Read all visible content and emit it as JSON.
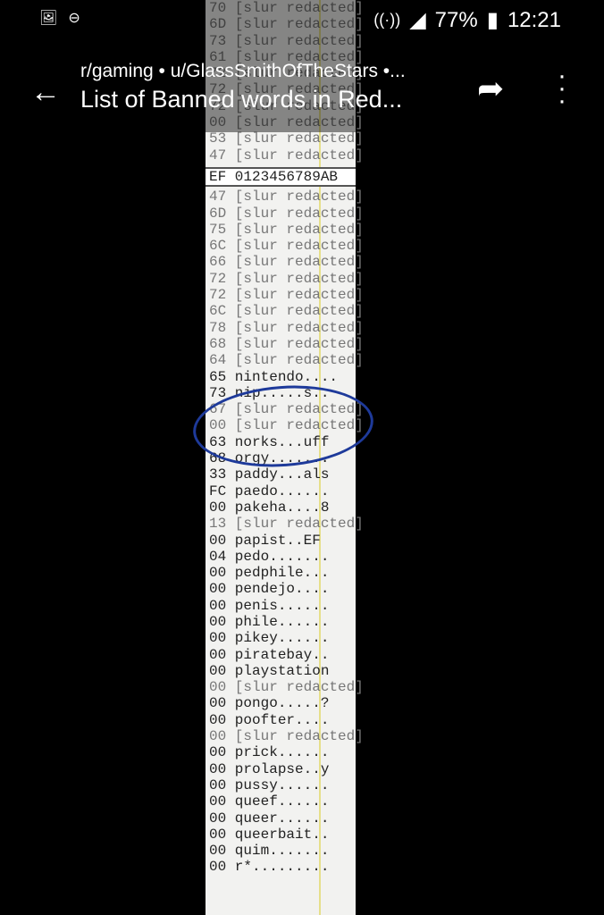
{
  "status_bar": {
    "icons_left": [
      "image-icon",
      "do-not-disturb-icon"
    ],
    "icons_right": [
      "bluetooth-icon",
      "alarm-icon",
      "volte-icon",
      "wifi-icon",
      "signal-icon"
    ],
    "battery": "77%",
    "time": "12:21"
  },
  "app_bar": {
    "subtitle": "r/gaming • u/GlassSmithOfTheStars •...",
    "title": "List of Banned words in Red..."
  },
  "dump": {
    "header": "EF 0123456789AB",
    "redacted_label": "[slur redacted]",
    "top_rows": [
      {
        "hex": "70",
        "word": null
      },
      {
        "hex": "6D",
        "word": null
      },
      {
        "hex": "73",
        "word": null
      },
      {
        "hex": "61",
        "word": null
      },
      {
        "hex": "72",
        "word": null
      },
      {
        "hex": "72",
        "word": null
      },
      {
        "hex": "72",
        "word": null
      },
      {
        "hex": "00",
        "word": null
      },
      {
        "hex": "53",
        "word": null
      },
      {
        "hex": "47",
        "word": null
      }
    ],
    "rows": [
      {
        "hex": "47",
        "word": null
      },
      {
        "hex": "6D",
        "word": null
      },
      {
        "hex": "75",
        "word": null
      },
      {
        "hex": "6C",
        "word": null
      },
      {
        "hex": "66",
        "word": null
      },
      {
        "hex": "72",
        "word": null
      },
      {
        "hex": "72",
        "word": null
      },
      {
        "hex": "6C",
        "word": null
      },
      {
        "hex": "78",
        "word": null
      },
      {
        "hex": "68",
        "word": null
      },
      {
        "hex": "64",
        "word": null
      },
      {
        "hex": "65",
        "word": "nintendo...."
      },
      {
        "hex": "73",
        "word": "nip.....s.."
      },
      {
        "hex": "67",
        "word": null
      },
      {
        "hex": "00",
        "word": null
      },
      {
        "hex": "63",
        "word": "norks...uff"
      },
      {
        "hex": "68",
        "word": "orgy......."
      },
      {
        "hex": "33",
        "word": "paddy...als"
      },
      {
        "hex": "FC",
        "word": "paedo......"
      },
      {
        "hex": "00",
        "word": "pakeha....8"
      },
      {
        "hex": "13",
        "word": null
      },
      {
        "hex": "00",
        "word": "papist..EF"
      },
      {
        "hex": "04",
        "word": "pedo......."
      },
      {
        "hex": "00",
        "word": "pedphile..."
      },
      {
        "hex": "00",
        "word": "pendejo...."
      },
      {
        "hex": "00",
        "word": "penis......"
      },
      {
        "hex": "00",
        "word": "phile......"
      },
      {
        "hex": "00",
        "word": "pikey......"
      },
      {
        "hex": "00",
        "word": "piratebay.."
      },
      {
        "hex": "00",
        "word": "playstation"
      },
      {
        "hex": "00",
        "word": null
      },
      {
        "hex": "00",
        "word": "pongo.....?"
      },
      {
        "hex": "00",
        "word": "poofter...."
      },
      {
        "hex": "00",
        "word": null
      },
      {
        "hex": "00",
        "word": "prick......"
      },
      {
        "hex": "00",
        "word": "prolapse..y"
      },
      {
        "hex": "00",
        "word": "pussy......"
      },
      {
        "hex": "00",
        "word": "queef......"
      },
      {
        "hex": "00",
        "word": "queer......"
      },
      {
        "hex": "00",
        "word": "queerbait.."
      },
      {
        "hex": "00",
        "word": "quim......."
      },
      {
        "hex": "00",
        "word": "r*........."
      }
    ]
  }
}
